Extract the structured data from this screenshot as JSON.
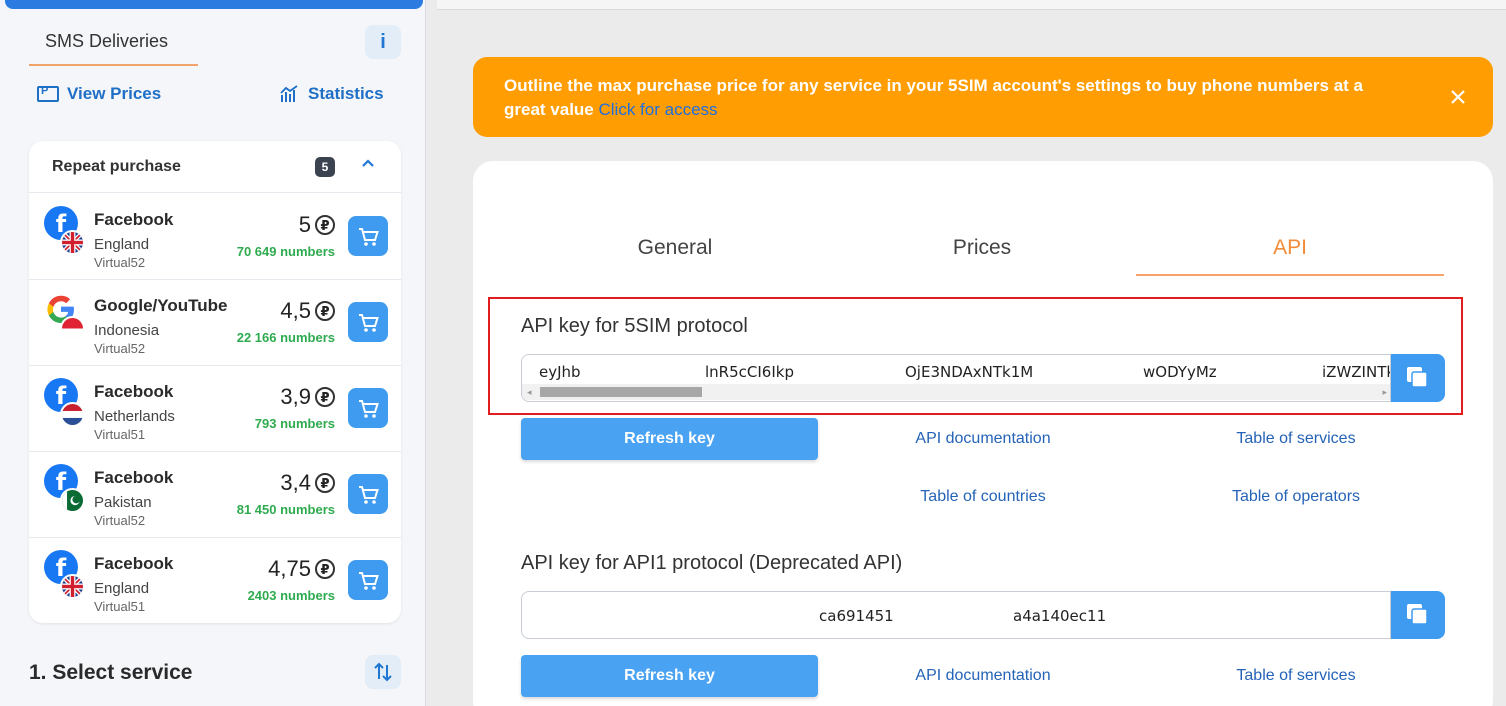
{
  "sidebar": {
    "title": "SMS Deliveries",
    "info_label": "i",
    "view_prices": "View Prices",
    "statistics": "Statistics",
    "repeat": {
      "title": "Repeat purchase",
      "count": "5",
      "items": [
        {
          "service": "Facebook",
          "country": "England",
          "operator": "Virtual52",
          "price": "5",
          "numbers": "70 649 numbers"
        },
        {
          "service": "Google/YouTube",
          "country": "Indonesia",
          "operator": "Virtual52",
          "price": "4,5",
          "numbers": "22 166 numbers"
        },
        {
          "service": "Facebook",
          "country": "Netherlands",
          "operator": "Virtual51",
          "price": "3,9",
          "numbers": "793 numbers"
        },
        {
          "service": "Facebook",
          "country": "Pakistan",
          "operator": "Virtual52",
          "price": "3,4",
          "numbers": "81 450 numbers"
        },
        {
          "service": "Facebook",
          "country": "England",
          "operator": "Virtual51",
          "price": "4,75",
          "numbers": "2403 numbers"
        }
      ]
    },
    "currency_symbol": "₽",
    "facebook_glyph": "f",
    "select_service": "1. Select service"
  },
  "banner": {
    "text": "Outline the max purchase price for any service in your 5SIM account's settings to buy phone numbers at a great value",
    "link": "Click for access"
  },
  "tabs": {
    "general": "General",
    "prices": "Prices",
    "api": "API"
  },
  "api_5sim": {
    "title": "API key for 5SIM protocol",
    "key_segments": [
      "eyJhb",
      "lnR5cCI6Ikp",
      "OjE3NDAxNTk1M",
      "wODYyMz",
      "iZWZINTk"
    ],
    "refresh": "Refresh key",
    "api_docs": "API documentation",
    "table_services": "Table of services",
    "table_countries": "Table of countries",
    "table_operators": "Table of operators"
  },
  "api_1": {
    "title": "API key for API1 protocol (Deprecated API)",
    "key_segments": [
      "ca691451",
      "a4a140ec11"
    ],
    "refresh": "Refresh key",
    "api_docs": "API documentation",
    "table_services": "Table of services"
  },
  "colors": {
    "accent_blue": "#3e9bf0",
    "banner_orange": "#ff9d02",
    "active_tab": "#f28c38",
    "numbers_green": "#2fab4f",
    "highlight_red": "#e21d1d"
  }
}
